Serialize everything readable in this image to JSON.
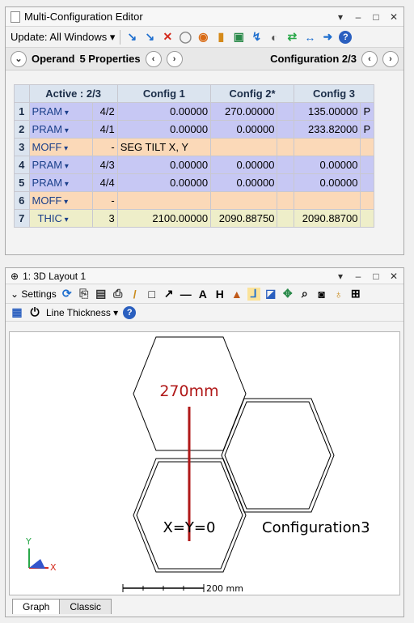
{
  "mce": {
    "title": "Multi-Configuration Editor",
    "toolbar": {
      "update_label": "Update: All Windows"
    },
    "nav": {
      "operand_label": "Operand",
      "properties_label": "5 Properties",
      "configuration_label": "Configuration 2/3"
    },
    "table": {
      "headers": [
        "Active : 2/3",
        "Config 1",
        "Config 2*",
        "Config 3"
      ],
      "rows": [
        {
          "num": "1",
          "op": "PRAM",
          "param": "4/2",
          "c1": "0.00000",
          "c2": "270.00000",
          "c3": "135.00000",
          "flag": "P"
        },
        {
          "num": "2",
          "op": "PRAM",
          "param": "4/1",
          "c1": "0.00000",
          "c2": "0.00000",
          "c3": "233.82000",
          "flag": "P"
        },
        {
          "num": "3",
          "op": "MOFF",
          "param": "-",
          "c1": "SEG TILT X, Y",
          "c2": "",
          "c3": "",
          "flag": ""
        },
        {
          "num": "4",
          "op": "PRAM",
          "param": "4/3",
          "c1": "0.00000",
          "c2": "0.00000",
          "c3": "0.00000",
          "flag": ""
        },
        {
          "num": "5",
          "op": "PRAM",
          "param": "4/4",
          "c1": "0.00000",
          "c2": "0.00000",
          "c3": "0.00000",
          "flag": ""
        },
        {
          "num": "6",
          "op": "MOFF",
          "param": "-",
          "c1": "",
          "c2": "",
          "c3": "",
          "flag": ""
        },
        {
          "num": "7",
          "op": "THIC",
          "param": "3",
          "c1": "2100.00000",
          "c2": "2090.88750",
          "c3": "2090.88700",
          "flag": ""
        }
      ]
    }
  },
  "layout": {
    "title": "1: 3D Layout 1",
    "toolbar": {
      "settings_label": "Settings",
      "line_thickness_label": "Line Thickness"
    },
    "canvas": {
      "label_270": "270mm",
      "label_origin": "X=Y=0",
      "label_config3": "Configuration3",
      "axis_y": "Y",
      "axis_x": "X",
      "scale_label": "200 mm"
    },
    "tabs": [
      "Graph",
      "Classic"
    ]
  },
  "colors": {
    "prm_row": "#c7c8f4",
    "moff_row": "#fbd9b8",
    "thic_row": "#eeeec9",
    "annotation": "#b01818"
  }
}
